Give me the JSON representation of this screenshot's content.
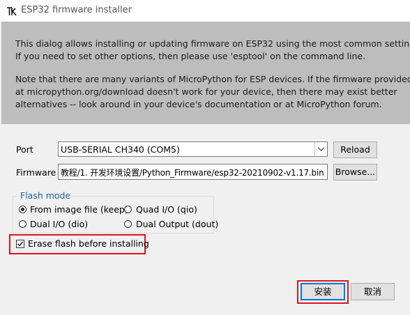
{
  "window": {
    "title": "ESP32 firmware installer",
    "icon": "tk-feather-icon"
  },
  "info": {
    "lines": [
      "This dialog allows installing or updating firmware on ESP32 using the most common settings.",
      "If you need to set other options, then please use 'esptool' on the command line.",
      "Note that there are many variants of MicroPython for ESP devices. If the firmware provided",
      "at micropython.org/download doesn't work for your device, then there may exist better",
      "alternatives -- look around in your device's documentation or at MicroPython forum."
    ]
  },
  "port": {
    "label": "Port",
    "value": "USB-SERIAL CH340 (COM5)",
    "reload_label": "Reload"
  },
  "firmware": {
    "label": "Firmware",
    "value": "教程/1. 开发环境设置/Python_Firmware/esp32-20210902-v1.17.bin",
    "browse_label": "Browse..."
  },
  "flash_mode": {
    "legend": "Flash mode",
    "options": [
      {
        "label": "From image file (keep)",
        "selected": true
      },
      {
        "label": "Quad I/O (qio)",
        "selected": false
      },
      {
        "label": "Dual I/O (dio)",
        "selected": false
      },
      {
        "label": "Dual Output (dout)",
        "selected": false
      }
    ]
  },
  "erase": {
    "label": "Erase flash before installing",
    "checked": true
  },
  "actions": {
    "install_label": "安装",
    "cancel_label": "取消"
  },
  "colors": {
    "highlight": "#e0141e",
    "info_background": "#bdbdbd",
    "legend_text": "#1f5faa"
  }
}
